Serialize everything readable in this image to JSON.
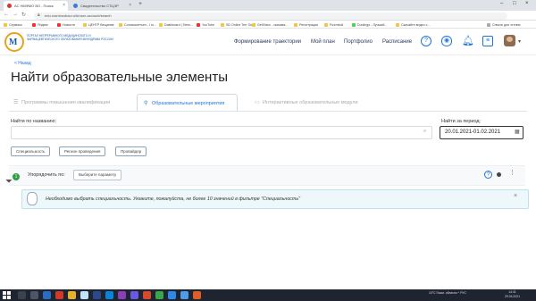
{
  "browser": {
    "tabs": [
      {
        "label": "АС НМФМО ВО - Поиск"
      },
      {
        "label": "Свидетельство СТЦЭР"
      }
    ],
    "new_tab": "+",
    "url": "edu.rosminzdrav.ru/#/user-account/search",
    "bookmarks": [
      "Сервисы",
      "Яндекс",
      "Новости",
      "ЦЕНТР Вещание",
      "Сотовоксетьел - i ro...",
      "Dashboard | Stree...",
      "YouTube",
      "SD Online Terr Siv",
      "GetVideo - скачива...",
      "Регистрация",
      "Fizzmindi",
      "Duolingo - Лучший...",
      "Скачайте видео с...",
      "Список для чтения"
    ]
  },
  "header": {
    "org_name": "Портал непрерывного медицинского и фармацевтического образования Минздрава России",
    "logo_letter": "М",
    "nav": [
      "Формирование траектории",
      "Мой план",
      "Портфолио",
      "Расписание"
    ],
    "icons": [
      "help-icon",
      "eye-icon",
      "bell-icon",
      "chat-icon"
    ]
  },
  "page": {
    "back": "< Назад",
    "title": "Найти образовательные элементы",
    "tabs": [
      {
        "label": "Программы повышения квалификации",
        "icon": "☰"
      },
      {
        "label": "Образовательные мероприятия",
        "icon": "⚲"
      },
      {
        "label": "Интерактивные образовательные модули",
        "icon": "▭"
      }
    ],
    "search_label": "Найти по названию:",
    "search_placeholder": "",
    "period_label": "Найти за период:",
    "period_value": "20.01.2021-01.02.2021",
    "chips": [
      "Специальность",
      "Регион проведения",
      "Провайдер"
    ],
    "sort_label": "Упорядочить по:",
    "sort_button": "Выберите параметр",
    "filter_count": "1",
    "alert_text": "Необходимо выбрать специальность. Укажите, пожалуйста, не более 10 значений в фильтре \"Специальность\""
  },
  "taskbar": {
    "tray": "10°C  Пасм. облачно  ^  РУС",
    "time": "14:31",
    "date": "29.04.2021"
  }
}
